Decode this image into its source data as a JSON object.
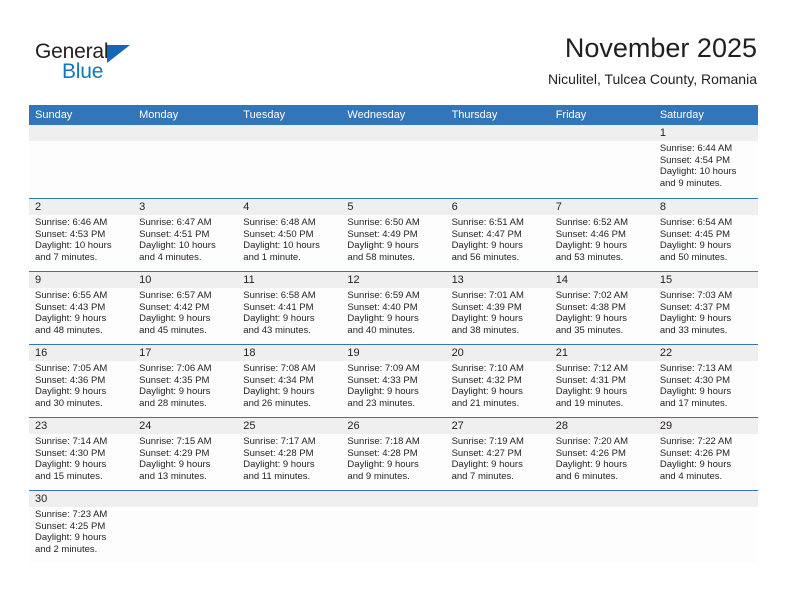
{
  "brand": {
    "name_line1": "General",
    "name_line2": "Blue",
    "accent_color": "#1576bd",
    "triangle_color": "#1567b5"
  },
  "header": {
    "title": "November 2025",
    "subtitle": "Niculitel, Tulcea County, Romania",
    "header_bg": "#3275b8",
    "daystrip_bg": "#efefef"
  },
  "weekdays": [
    "Sunday",
    "Monday",
    "Tuesday",
    "Wednesday",
    "Thursday",
    "Friday",
    "Saturday"
  ],
  "weeks": [
    [
      {
        "day": "",
        "info": ""
      },
      {
        "day": "",
        "info": ""
      },
      {
        "day": "",
        "info": ""
      },
      {
        "day": "",
        "info": ""
      },
      {
        "day": "",
        "info": ""
      },
      {
        "day": "",
        "info": ""
      },
      {
        "day": "1",
        "info": "Sunrise: 6:44 AM\nSunset: 4:54 PM\nDaylight: 10 hours\nand 9 minutes."
      }
    ],
    [
      {
        "day": "2",
        "info": "Sunrise: 6:46 AM\nSunset: 4:53 PM\nDaylight: 10 hours\nand 7 minutes."
      },
      {
        "day": "3",
        "info": "Sunrise: 6:47 AM\nSunset: 4:51 PM\nDaylight: 10 hours\nand 4 minutes."
      },
      {
        "day": "4",
        "info": "Sunrise: 6:48 AM\nSunset: 4:50 PM\nDaylight: 10 hours\nand 1 minute."
      },
      {
        "day": "5",
        "info": "Sunrise: 6:50 AM\nSunset: 4:49 PM\nDaylight: 9 hours\nand 58 minutes."
      },
      {
        "day": "6",
        "info": "Sunrise: 6:51 AM\nSunset: 4:47 PM\nDaylight: 9 hours\nand 56 minutes."
      },
      {
        "day": "7",
        "info": "Sunrise: 6:52 AM\nSunset: 4:46 PM\nDaylight: 9 hours\nand 53 minutes."
      },
      {
        "day": "8",
        "info": "Sunrise: 6:54 AM\nSunset: 4:45 PM\nDaylight: 9 hours\nand 50 minutes."
      }
    ],
    [
      {
        "day": "9",
        "info": "Sunrise: 6:55 AM\nSunset: 4:43 PM\nDaylight: 9 hours\nand 48 minutes."
      },
      {
        "day": "10",
        "info": "Sunrise: 6:57 AM\nSunset: 4:42 PM\nDaylight: 9 hours\nand 45 minutes."
      },
      {
        "day": "11",
        "info": "Sunrise: 6:58 AM\nSunset: 4:41 PM\nDaylight: 9 hours\nand 43 minutes."
      },
      {
        "day": "12",
        "info": "Sunrise: 6:59 AM\nSunset: 4:40 PM\nDaylight: 9 hours\nand 40 minutes."
      },
      {
        "day": "13",
        "info": "Sunrise: 7:01 AM\nSunset: 4:39 PM\nDaylight: 9 hours\nand 38 minutes."
      },
      {
        "day": "14",
        "info": "Sunrise: 7:02 AM\nSunset: 4:38 PM\nDaylight: 9 hours\nand 35 minutes."
      },
      {
        "day": "15",
        "info": "Sunrise: 7:03 AM\nSunset: 4:37 PM\nDaylight: 9 hours\nand 33 minutes."
      }
    ],
    [
      {
        "day": "16",
        "info": "Sunrise: 7:05 AM\nSunset: 4:36 PM\nDaylight: 9 hours\nand 30 minutes."
      },
      {
        "day": "17",
        "info": "Sunrise: 7:06 AM\nSunset: 4:35 PM\nDaylight: 9 hours\nand 28 minutes."
      },
      {
        "day": "18",
        "info": "Sunrise: 7:08 AM\nSunset: 4:34 PM\nDaylight: 9 hours\nand 26 minutes."
      },
      {
        "day": "19",
        "info": "Sunrise: 7:09 AM\nSunset: 4:33 PM\nDaylight: 9 hours\nand 23 minutes."
      },
      {
        "day": "20",
        "info": "Sunrise: 7:10 AM\nSunset: 4:32 PM\nDaylight: 9 hours\nand 21 minutes."
      },
      {
        "day": "21",
        "info": "Sunrise: 7:12 AM\nSunset: 4:31 PM\nDaylight: 9 hours\nand 19 minutes."
      },
      {
        "day": "22",
        "info": "Sunrise: 7:13 AM\nSunset: 4:30 PM\nDaylight: 9 hours\nand 17 minutes."
      }
    ],
    [
      {
        "day": "23",
        "info": "Sunrise: 7:14 AM\nSunset: 4:30 PM\nDaylight: 9 hours\nand 15 minutes."
      },
      {
        "day": "24",
        "info": "Sunrise: 7:15 AM\nSunset: 4:29 PM\nDaylight: 9 hours\nand 13 minutes."
      },
      {
        "day": "25",
        "info": "Sunrise: 7:17 AM\nSunset: 4:28 PM\nDaylight: 9 hours\nand 11 minutes."
      },
      {
        "day": "26",
        "info": "Sunrise: 7:18 AM\nSunset: 4:28 PM\nDaylight: 9 hours\nand 9 minutes."
      },
      {
        "day": "27",
        "info": "Sunrise: 7:19 AM\nSunset: 4:27 PM\nDaylight: 9 hours\nand 7 minutes."
      },
      {
        "day": "28",
        "info": "Sunrise: 7:20 AM\nSunset: 4:26 PM\nDaylight: 9 hours\nand 6 minutes."
      },
      {
        "day": "29",
        "info": "Sunrise: 7:22 AM\nSunset: 4:26 PM\nDaylight: 9 hours\nand 4 minutes."
      }
    ],
    [
      {
        "day": "30",
        "info": "Sunrise: 7:23 AM\nSunset: 4:25 PM\nDaylight: 9 hours\nand 2 minutes."
      },
      {
        "day": "",
        "info": ""
      },
      {
        "day": "",
        "info": ""
      },
      {
        "day": "",
        "info": ""
      },
      {
        "day": "",
        "info": ""
      },
      {
        "day": "",
        "info": ""
      },
      {
        "day": "",
        "info": ""
      }
    ]
  ]
}
